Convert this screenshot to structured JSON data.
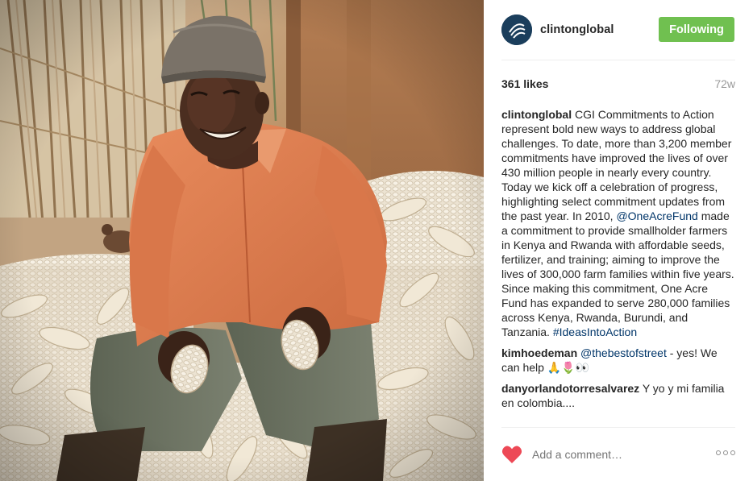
{
  "post": {
    "photo_icon": "photo-farmer-with-maize",
    "colors": {
      "follow_button": "#70c050",
      "link": "#003569",
      "like_heart": "#ed4956",
      "muted": "#999999"
    }
  },
  "header": {
    "username": "clintonglobal",
    "avatar_icon": "cgi-logo-icon",
    "follow_label": "Following"
  },
  "meta": {
    "likes": "361 likes",
    "age": "72w"
  },
  "comments": [
    {
      "author": "clintonglobal",
      "text_1": "CGI Commitments to Action represent bold new ways to address global challenges. To date, more than 3,200 member commitments have improved the lives of over 430 million people in nearly every country. Today we kick off a celebration of progress, highlighting select commitment updates from the past year. In 2010,",
      "mention": "@OneAcreFund",
      "text_2": "made a commitment to provide smallholder farmers in Kenya and Rwanda with affordable seeds, fertilizer, and training; aiming to improve the lives of 300,000 farm families within five years. Since making this commitment, One Acre Fund has expanded to serve 280,000 families across Kenya, Rwanda, Burundi, and Tanzania.",
      "hashtag": "#IdeasIntoAction"
    },
    {
      "author": "kimhoedeman",
      "mention": "@thebestofstreet",
      "text": "- yes! We can help 🙏🌷👀"
    },
    {
      "author": "danyorlandotorresalvarez",
      "text": "Y yo y mi familia en colombia...."
    }
  ],
  "footer": {
    "like_icon": "heart-icon",
    "add_comment_placeholder": "Add a comment…",
    "more_icon": "more-options-icon"
  }
}
